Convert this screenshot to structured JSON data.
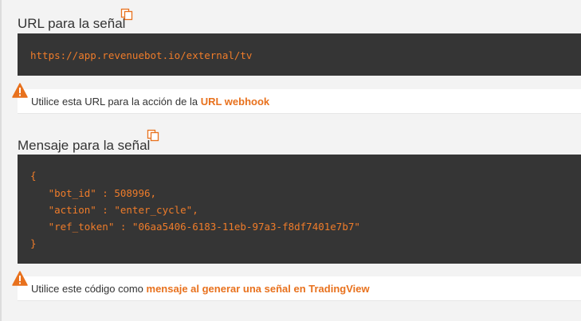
{
  "url_section": {
    "title": "URL para la señal",
    "url": "https://app.revenuebot.io/external/tv",
    "note_prefix": "Utilice esta URL para la acción de la ",
    "note_link": "URL webhook"
  },
  "message_section": {
    "title": "Mensaje para la señal",
    "code_lines": [
      "{",
      "   \"bot_id\" : 508996,",
      "   \"action\" : \"enter_cycle\",",
      "   \"ref_token\" : \"06aa5406-6183-11eb-97a3-f8df7401e7b7\"",
      "}"
    ],
    "note_prefix": "Utilice este código como ",
    "note_link": "mensaje al generar una señal en TradingView"
  },
  "icons": {
    "copy": "copy-icon",
    "warning": "warning-icon"
  },
  "colors": {
    "accent": "#e8711d",
    "code_bg": "#353535",
    "code_text": "#ef7c2a"
  }
}
